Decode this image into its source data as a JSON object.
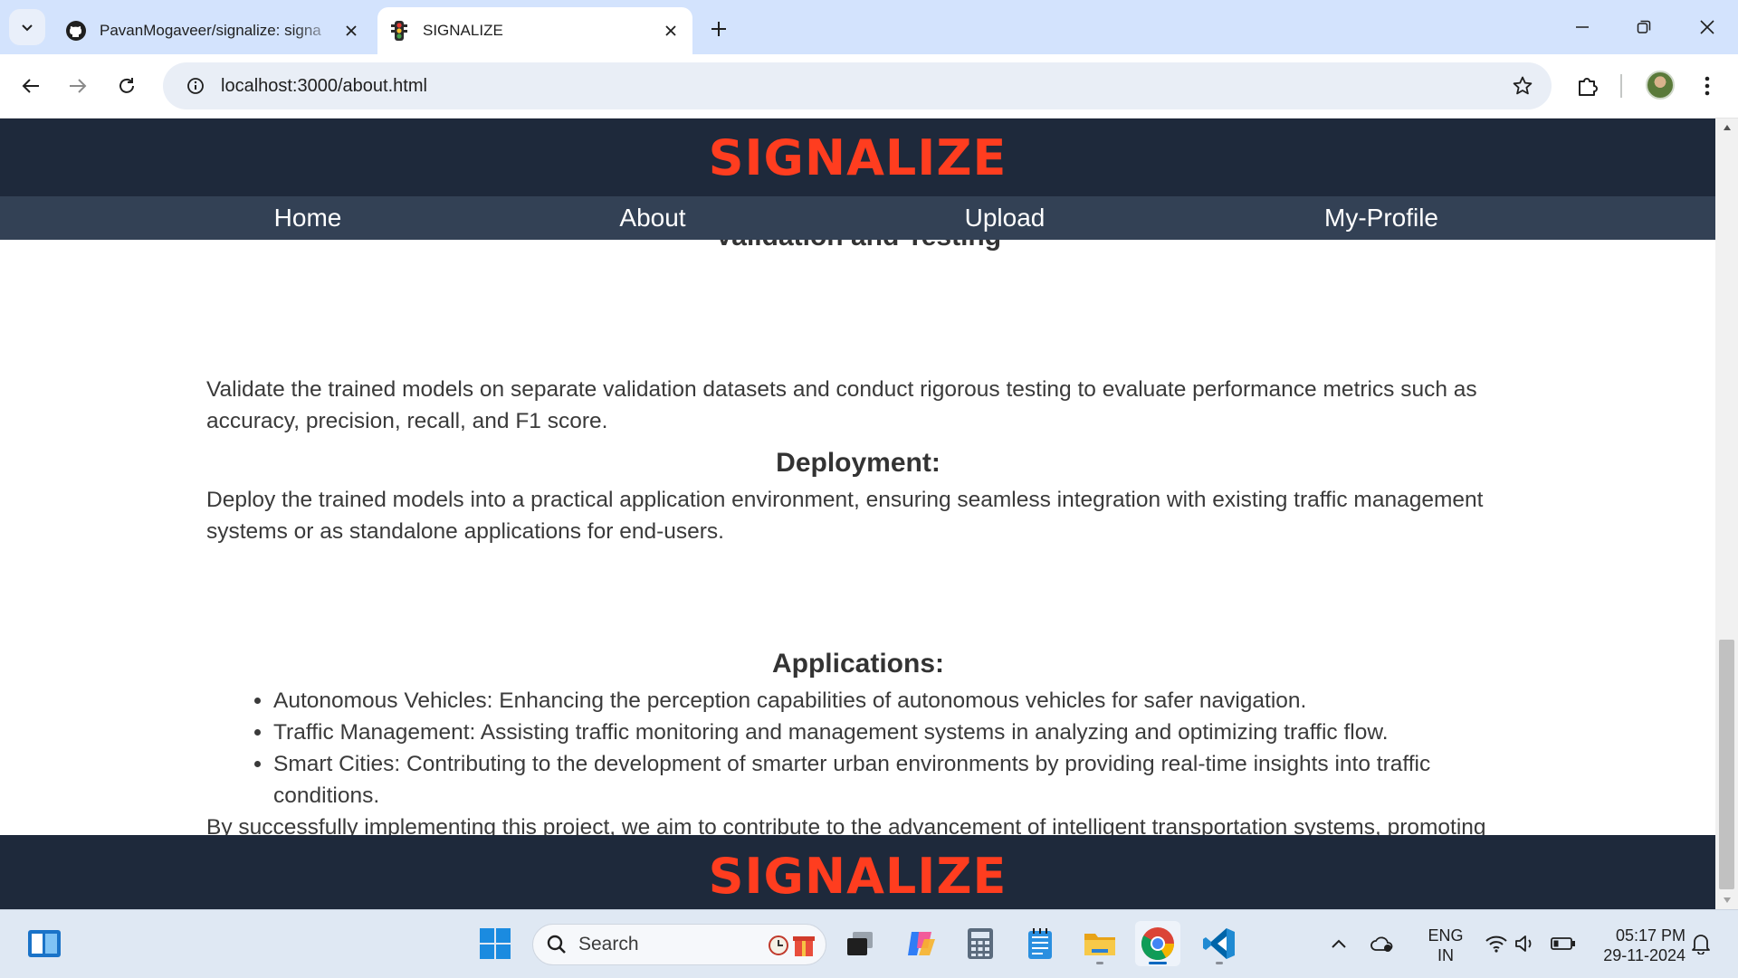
{
  "browser": {
    "tabs": [
      {
        "title": "PavanMogaveer/signalize: signa",
        "favicon": "github-icon",
        "active": false
      },
      {
        "title": "SIGNALIZE",
        "favicon": "traffic-light-icon",
        "active": true
      }
    ],
    "address": "localhost:3000/about.html"
  },
  "site": {
    "logo": "SIGNALIZE",
    "nav": [
      "Home",
      "About",
      "Upload",
      "My-Profile"
    ],
    "footer_logo": "SIGNALIZE"
  },
  "content": {
    "clipped_heading": "Validation and Testing",
    "validation_text": "Validate the trained models on separate validation datasets and conduct rigorous testing to evaluate performance metrics such as accuracy, precision, recall, and F1 score.",
    "deployment_heading": "Deployment:",
    "deployment_text": "Deploy the trained models into a practical application environment, ensuring seamless integration with existing traffic management systems or as standalone applications for end-users.",
    "applications_heading": "Applications:",
    "applications": [
      "Autonomous Vehicles: Enhancing the perception capabilities of autonomous vehicles for safer navigation.",
      "Traffic Management: Assisting traffic monitoring and management systems in analyzing and optimizing traffic flow.",
      "Smart Cities: Contributing to the development of smarter urban environments by providing real-time insights into traffic conditions."
    ],
    "conclusion": "By successfully implementing this project, we aim to contribute to the advancement of intelligent transportation systems, promoting safer and more efficient traffic management solutions."
  },
  "taskbar": {
    "search_label": "Search",
    "language": "ENG",
    "region": "IN",
    "time": "05:17 PM",
    "date": "29-11-2024"
  },
  "colors": {
    "logo": "#ff3d1f",
    "header_bg": "#1e293b",
    "nav_bg": "#334155"
  }
}
